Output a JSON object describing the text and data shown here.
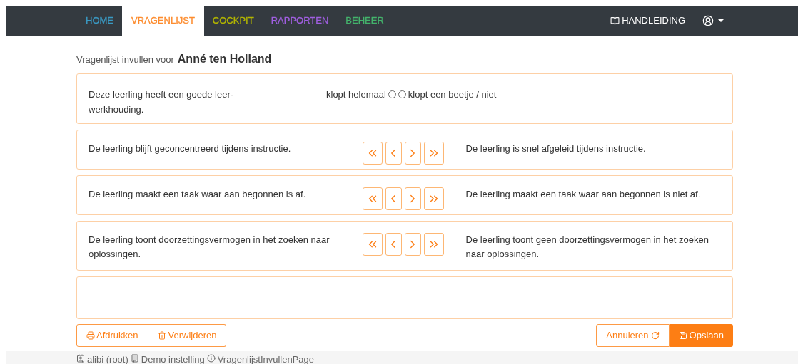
{
  "nav": {
    "tabs": [
      {
        "label": "HOME",
        "color": "#3a9ac4",
        "selected": false
      },
      {
        "label": "VRAGENLIJST",
        "color": "#fd8c2e",
        "selected": true
      },
      {
        "label": "COCKPIT",
        "color": "#b2b500",
        "selected": false
      },
      {
        "label": "RAPPORTEN",
        "color": "#a05fe0",
        "selected": false
      },
      {
        "label": "BEHEER",
        "color": "#44b36c",
        "selected": false
      }
    ],
    "manual": "HANDLEIDING"
  },
  "heading": {
    "prefix": "Vragenlijst invullen voor",
    "name": "Anné ten Holland"
  },
  "questions": [
    {
      "kind": "radio",
      "text": "Deze leerling heeft een goede leer-werkhouding.",
      "options": [
        {
          "label": "klopt helemaal",
          "checked": false
        },
        {
          "label": "klopt een beetje / niet",
          "checked": false
        }
      ]
    },
    {
      "kind": "scale",
      "left": "De leerling blijft geconcentreerd tijdens instructie.",
      "right": "De leerling is snel afgeleid tijdens instructie."
    },
    {
      "kind": "scale",
      "left": "De leerling maakt een taak waar aan begonnen is af.",
      "right": "De leerling maakt een taak waar aan begonnen is niet af."
    },
    {
      "kind": "scale",
      "left": "De leerling toont doorzettingsvermogen in het zoeken naar oplossingen.",
      "right": "De leerling toont geen doorzettingsvermogen in het zoeken naar oplossingen."
    }
  ],
  "actions": {
    "print": "Afdrukken",
    "delete": "Verwijderen",
    "cancel": "Annuleren",
    "save": "Opslaan"
  },
  "footer": {
    "user": "alibi (root)",
    "institution": "Demo instelling",
    "page": "VragenlijstInvullenPage"
  }
}
